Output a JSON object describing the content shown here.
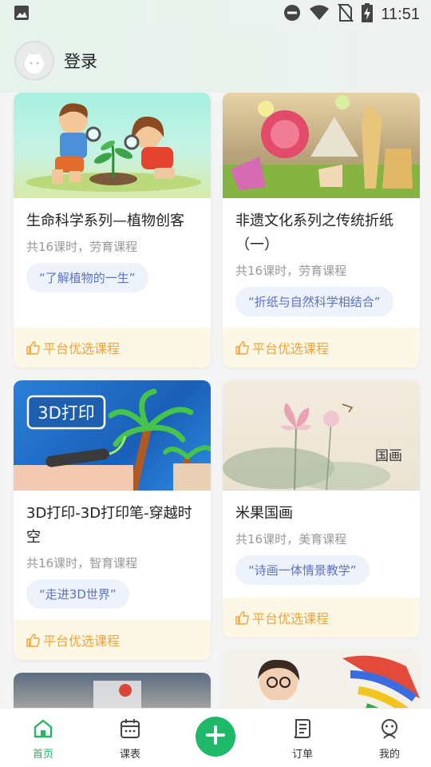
{
  "status_bar": {
    "time": "11:51",
    "icons": [
      "image-icon",
      "dnd-icon",
      "wifi-icon",
      "no-sim-icon",
      "battery-charging-icon"
    ]
  },
  "header": {
    "login_label": "登录",
    "avatar_icon": "android-avatar-icon"
  },
  "courses": [
    {
      "title": "生命科学系列—植物创客",
      "meta": "共16课时，劳育课程",
      "tag": "“了解植物的一生”",
      "footer": "平台优选课程"
    },
    {
      "title": "非遗文化系列之传统折纸（一）",
      "meta": "共16课时，劳育课程",
      "tag": "“折纸与自然科学相结合”",
      "footer": "平台优选课程"
    },
    {
      "title": "3D打印-3D打印笔-穿越时空",
      "meta": "共16课时，智育课程",
      "tag": "“走进3D世界”",
      "footer": "平台优选课程",
      "image_badge": "3D打印"
    },
    {
      "title": "米果国画",
      "meta": "共16课时，美育课程",
      "tag": "“诗画一体情景教学”",
      "footer": "平台优选课程",
      "image_badge": "国画"
    }
  ],
  "bottom_nav": {
    "items": [
      {
        "label": "首页",
        "icon": "home-icon"
      },
      {
        "label": "课表",
        "icon": "calendar-icon"
      },
      {
        "label": "",
        "icon": "plus-icon"
      },
      {
        "label": "订单",
        "icon": "order-icon"
      },
      {
        "label": "我的",
        "icon": "profile-icon"
      }
    ]
  },
  "colors": {
    "accent": "#27b566",
    "tag_text": "#5a73c9",
    "footer_text": "#f1a33b",
    "footer_bg": "#fdf8e6"
  }
}
